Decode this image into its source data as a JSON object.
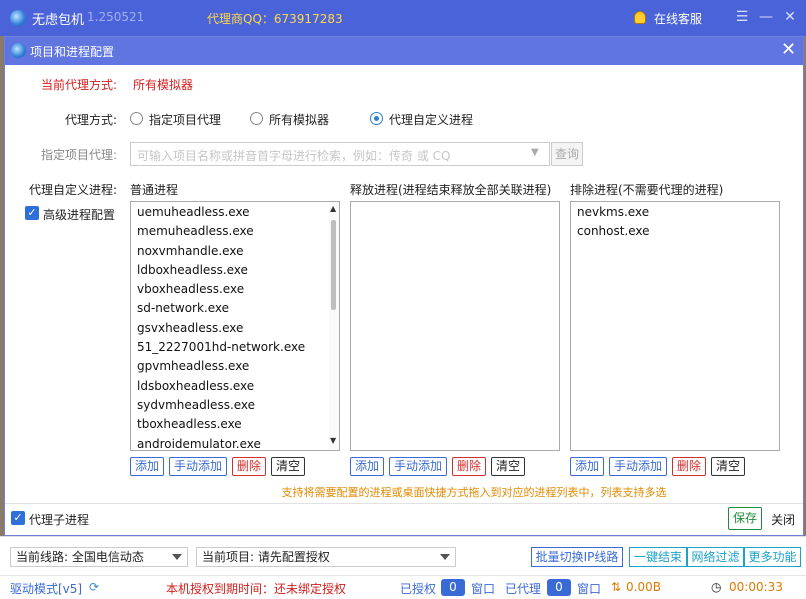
{
  "window": {
    "app_name": "无虑包机",
    "version": "1.250521",
    "agent_qq": "代理商QQ：673917283",
    "online_service": "在线客服"
  },
  "dialog": {
    "title": "项目和进程配置",
    "current_mode_label": "当前代理方式:",
    "current_mode_value": "所有模拟器",
    "mode_label": "代理方式:",
    "modes": [
      "指定项目代理",
      "所有模拟器",
      "代理自定义进程"
    ],
    "mode_selected": "代理自定义进程",
    "project_label": "指定项目代理:",
    "project_placeholder": "可输入项目名称或拼音首字母进行检索，例如：传奇 或 CQ",
    "query_btn": "查询",
    "custom_label": "代理自定义进程:",
    "advanced_label": "高级进程配置",
    "advanced_checked": true,
    "normal_title": "普通进程",
    "normal_items": [
      "uemuheadless.exe",
      "memuheadless.exe",
      "noxvmhandle.exe",
      "ldboxheadless.exe",
      "vboxheadless.exe",
      "sd-network.exe",
      "gsvxheadless.exe",
      "51_2227001hd-network.exe",
      "gpvmheadless.exe",
      "ldsboxheadless.exe",
      "sydvmheadless.exe",
      "tboxheadless.exe",
      "androidemulator.exe"
    ],
    "release_title": "释放进程(进程结束释放全部关联进程)",
    "release_items": [],
    "exclude_title": "排除进程(不需要代理的进程)",
    "exclude_items": [
      "nevkms.exe",
      "conhost.exe"
    ],
    "btn_add": "添加",
    "btn_manual_add": "手动添加",
    "btn_delete": "删除",
    "btn_clear": "清空",
    "hint": "支持将需要配置的进程或桌面快捷方式拖入到对应的进程列表中，列表支持多选",
    "child_proc_label": "代理子进程",
    "child_proc_checked": true,
    "save": "保存",
    "close": "关闭"
  },
  "bottom": {
    "line_label": "当前线路:",
    "line_value": "全国电信动态",
    "project_label": "当前项目:",
    "project_value": "请先配置授权",
    "btn_batch": "批量切换IP线路",
    "btn_end": "一键结束",
    "btn_filter": "网络过滤",
    "btn_more": "更多功能"
  },
  "status": {
    "driver_mode": "驱动模式[v5]",
    "license": "本机授权到期时间：还未绑定授权",
    "authorized_label": "已授权",
    "authorized_count": "0",
    "window_label1": "窗口",
    "proxied_label": "已代理",
    "proxied_count": "0",
    "window_label2": "窗口",
    "traffic": "0.00B",
    "elapsed": "00:00:33"
  },
  "colors": {
    "title_bar": "#4b63d9",
    "dialog_header": "#6075e0",
    "accent": "#3a6ad6",
    "danger": "#d02020",
    "warning": "#e08a00",
    "save": "#1f8a3a"
  }
}
